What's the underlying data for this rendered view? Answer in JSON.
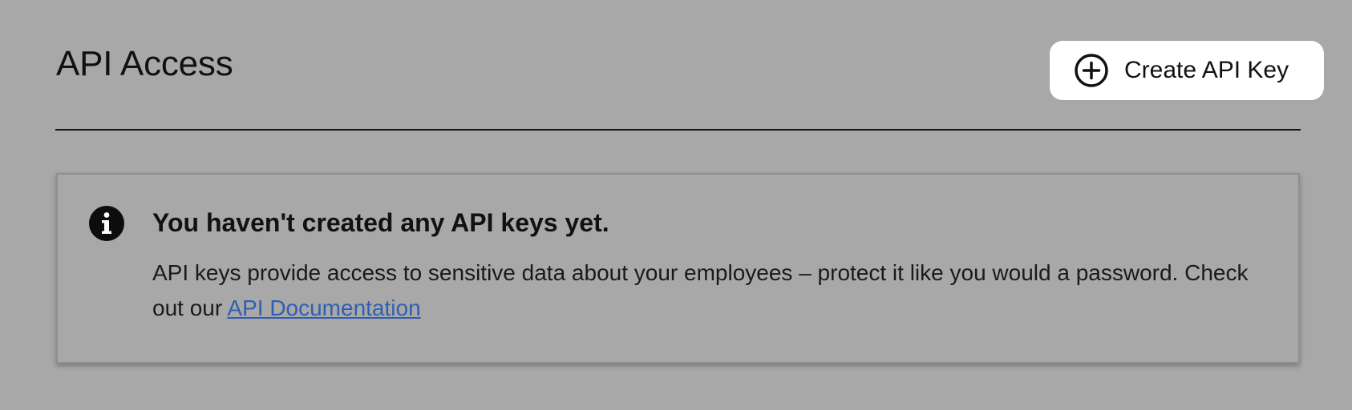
{
  "header": {
    "title": "API Access",
    "create_button_label": "Create API Key"
  },
  "notice": {
    "title": "You haven't created any API keys yet.",
    "body_text": "API keys provide access to sensitive data about your employees – protect it like you would a password. Check out our ",
    "link_label": "API Documentation"
  },
  "colors": {
    "background": "#a8a8a8",
    "button_background": "#ffffff",
    "link": "#2f5fb3",
    "text": "#111111"
  },
  "icons": {
    "create_button": "plus-circle-icon",
    "notice": "info-icon"
  }
}
